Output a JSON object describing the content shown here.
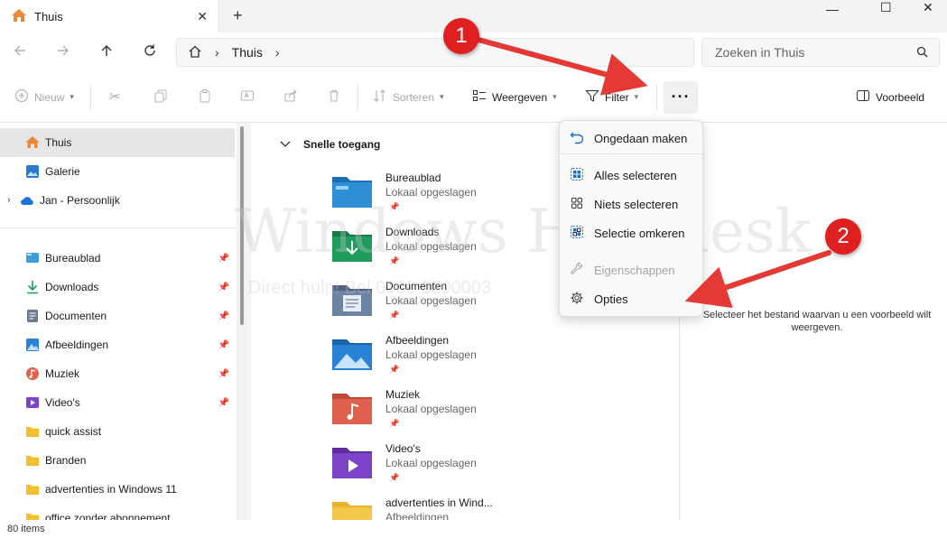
{
  "tab": {
    "title": "Thuis",
    "close": "✕",
    "new": "+"
  },
  "window_controls": {
    "minimize": "—",
    "maximize": "☐",
    "close": "✕"
  },
  "address": {
    "home_glyph": "⌂",
    "sep": "›",
    "location": "Thuis",
    "search_placeholder": "Zoeken in Thuis"
  },
  "toolbar": {
    "new_label": "Nieuw",
    "sort_label": "Sorteren",
    "view_label": "Weergeven",
    "filter_label": "Filter",
    "more_label": "···",
    "preview_label": "Voorbeeld"
  },
  "sidebar": {
    "top_items": [
      {
        "label": "Thuis",
        "icon": "home-icon",
        "color": "#e8893a"
      },
      {
        "label": "Galerie",
        "icon": "gallery-icon",
        "color": "#2a78d0"
      },
      {
        "label": "Jan - Persoonlijk",
        "icon": "cloud-icon",
        "color": "#1a73d6"
      }
    ],
    "items": [
      {
        "label": "Bureaublad",
        "icon": "desktop-icon",
        "color": "#3a9fd8"
      },
      {
        "label": "Downloads",
        "icon": "download-icon",
        "color": "#1b9e5a"
      },
      {
        "label": "Documenten",
        "icon": "documents-icon",
        "color": "#6b7b8f"
      },
      {
        "label": "Afbeeldingen",
        "icon": "pictures-icon",
        "color": "#2a82d4"
      },
      {
        "label": "Muziek",
        "icon": "music-icon",
        "color": "#e0604e"
      },
      {
        "label": "Video's",
        "icon": "video-icon",
        "color": "#7d43c9"
      },
      {
        "label": "quick assist",
        "icon": "folder-icon",
        "color": "#f0c030"
      },
      {
        "label": "Branden",
        "icon": "folder-icon",
        "color": "#f0c030"
      },
      {
        "label": "advertenties in Windows 11",
        "icon": "folder-icon",
        "color": "#f0c030"
      },
      {
        "label": "office zonder abonnement",
        "icon": "folder-icon",
        "color": "#f0c030"
      }
    ]
  },
  "main": {
    "section_title": "Snelle toegang",
    "items": [
      {
        "name": "Bureaublad",
        "sub": "Lokaal opgeslagen",
        "color": "#2e8fd6"
      },
      {
        "name": "Downloads",
        "sub": "Lokaal opgeslagen",
        "color": "#1d9c5c"
      },
      {
        "name": "Documenten",
        "sub": "Lokaal opgeslagen",
        "color": "#6e84a4"
      },
      {
        "name": "Afbeeldingen",
        "sub": "Lokaal opgeslagen",
        "color": "#2a82d4"
      },
      {
        "name": "Muziek",
        "sub": "Lokaal opgeslagen",
        "color": "#e0604e"
      },
      {
        "name": "Video's",
        "sub": "Lokaal opgeslagen",
        "color": "#7d43c9"
      },
      {
        "name": "advertenties in Wind...",
        "sub": "Afbeeldingen",
        "color": "#f4c84a"
      }
    ]
  },
  "menu": {
    "items": [
      {
        "label": "Ongedaan maken",
        "icon": "undo-icon",
        "glyph": "↶",
        "enabled": true
      },
      {
        "label": "Alles selecteren",
        "icon": "select-all-icon",
        "glyph": "▦",
        "enabled": true
      },
      {
        "label": "Niets selecteren",
        "icon": "select-none-icon",
        "glyph": "⬚",
        "enabled": true
      },
      {
        "label": "Selectie omkeren",
        "icon": "invert-selection-icon",
        "glyph": "▣",
        "enabled": true
      },
      {
        "label": "Eigenschappen",
        "icon": "properties-icon",
        "glyph": "🔧",
        "enabled": false
      },
      {
        "label": "Opties",
        "icon": "options-gear-icon",
        "glyph": "⚙",
        "enabled": true
      }
    ]
  },
  "preview": {
    "message": "Selecteer het bestand waarvan u een voorbeeld wilt weergeven."
  },
  "status": {
    "item_count": "80 items"
  },
  "annotations": {
    "badge1": "1",
    "badge2": "2",
    "color": "#e02020"
  },
  "watermark": {
    "line1": "Windows Helpdesk",
    "line2": "Direct hulp! Bel 0900 3300003"
  }
}
